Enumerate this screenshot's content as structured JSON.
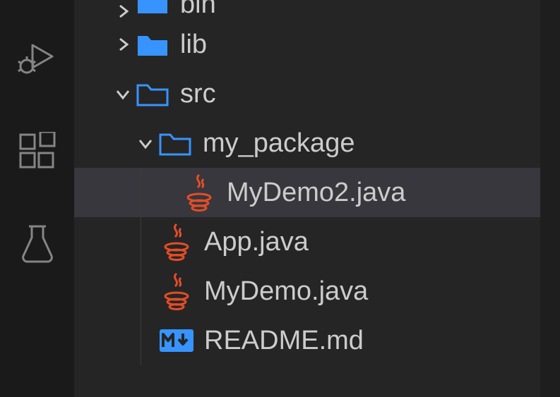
{
  "activity": {
    "icons": [
      "run-debug-icon",
      "extensions-icon",
      "testing-icon"
    ]
  },
  "tree": {
    "bin": {
      "label": "bin"
    },
    "lib": {
      "label": "lib"
    },
    "src": {
      "label": "src"
    },
    "my_package": {
      "label": "my_package"
    },
    "mydemo2": {
      "label": "MyDemo2.java"
    },
    "app": {
      "label": "App.java"
    },
    "mydemo": {
      "label": "MyDemo.java"
    },
    "readme": {
      "label": "README.md"
    }
  },
  "colors": {
    "folder_filled": "#3794ff",
    "folder_outline": "#3794ff",
    "java": "#e44d26",
    "markdown_bg": "#3794ff"
  }
}
